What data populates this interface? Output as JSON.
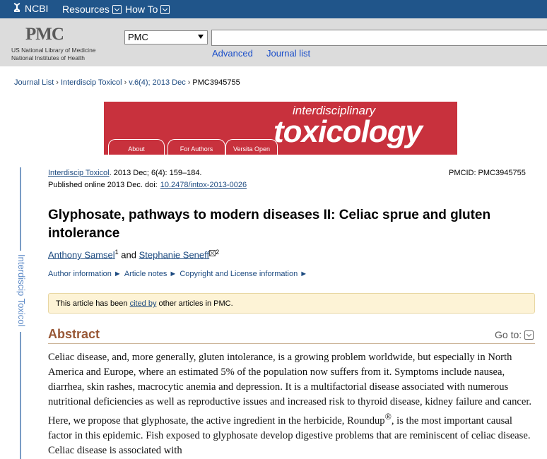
{
  "ncbi_bar": {
    "logo": "NCBI",
    "resources_label": "Resources",
    "howto_label": "How To"
  },
  "search": {
    "pmc_logo": "PMC",
    "nlm_line1": "US National Library of Medicine",
    "nlm_line2": "National Institutes of Health",
    "database": "PMC",
    "query": "",
    "advanced_label": "Advanced",
    "journal_list_label": "Journal list"
  },
  "breadcrumb": {
    "items": [
      "Journal List",
      "Interdiscip Toxicol",
      "v.6(4); 2013 Dec",
      "PMC3945755"
    ]
  },
  "banner": {
    "title_small": "interdisciplinary",
    "title_large": "toxicology",
    "tabs": [
      "About",
      "For Authors",
      "Versita Open"
    ]
  },
  "sidebar": {
    "journal_label": "Interdiscip Toxicol"
  },
  "article": {
    "journal_link": "Interdiscip Toxicol",
    "citation": ". 2013 Dec; 6(4): 159–184.",
    "published": "Published online 2013 Dec. doi:",
    "doi": "10.2478/intox-2013-0026",
    "pmcid": "PMCID: PMC3945755",
    "title": "Glyphosate, pathways to modern diseases II: Celiac sprue and gluten intolerance",
    "author1": "Anthony Samsel",
    "author1_sup": "1",
    "and": " and ",
    "author2": "Stephanie Seneff",
    "author2_sup": "2",
    "info_links": [
      "Author information ►",
      "Article notes ►",
      "Copyright and License information ►"
    ]
  },
  "cited": {
    "before": "This article has been ",
    "link": "cited by",
    "after": " other articles in PMC."
  },
  "abstract": {
    "heading": "Abstract",
    "goto_label": "Go to:",
    "text_part1": "Celiac disease, and, more generally, gluten intolerance, is a growing problem worldwide, but especially in North America and Europe, where an estimated 5% of the population now suffers from it. Symptoms include nausea, diarrhea, skin rashes, macrocytic anemia and depression. It is a multifactorial disease associated with numerous nutritional deficiencies as well as reproductive issues and increased risk to thyroid disease, kidney failure and cancer. Here, we propose that glyphosate, the active ingredient in the herbicide, Roundup",
    "registered": "®",
    "text_part2": ", is the most important causal factor in this epidemic. Fish exposed to glyphosate develop digestive problems that are reminiscent of celiac disease. Celiac disease is associated with"
  },
  "colors": {
    "ncbi_blue": "#20558a",
    "banner_red": "#c8313d",
    "link_blue": "#1c4a80",
    "abstract_brown": "#985735"
  }
}
